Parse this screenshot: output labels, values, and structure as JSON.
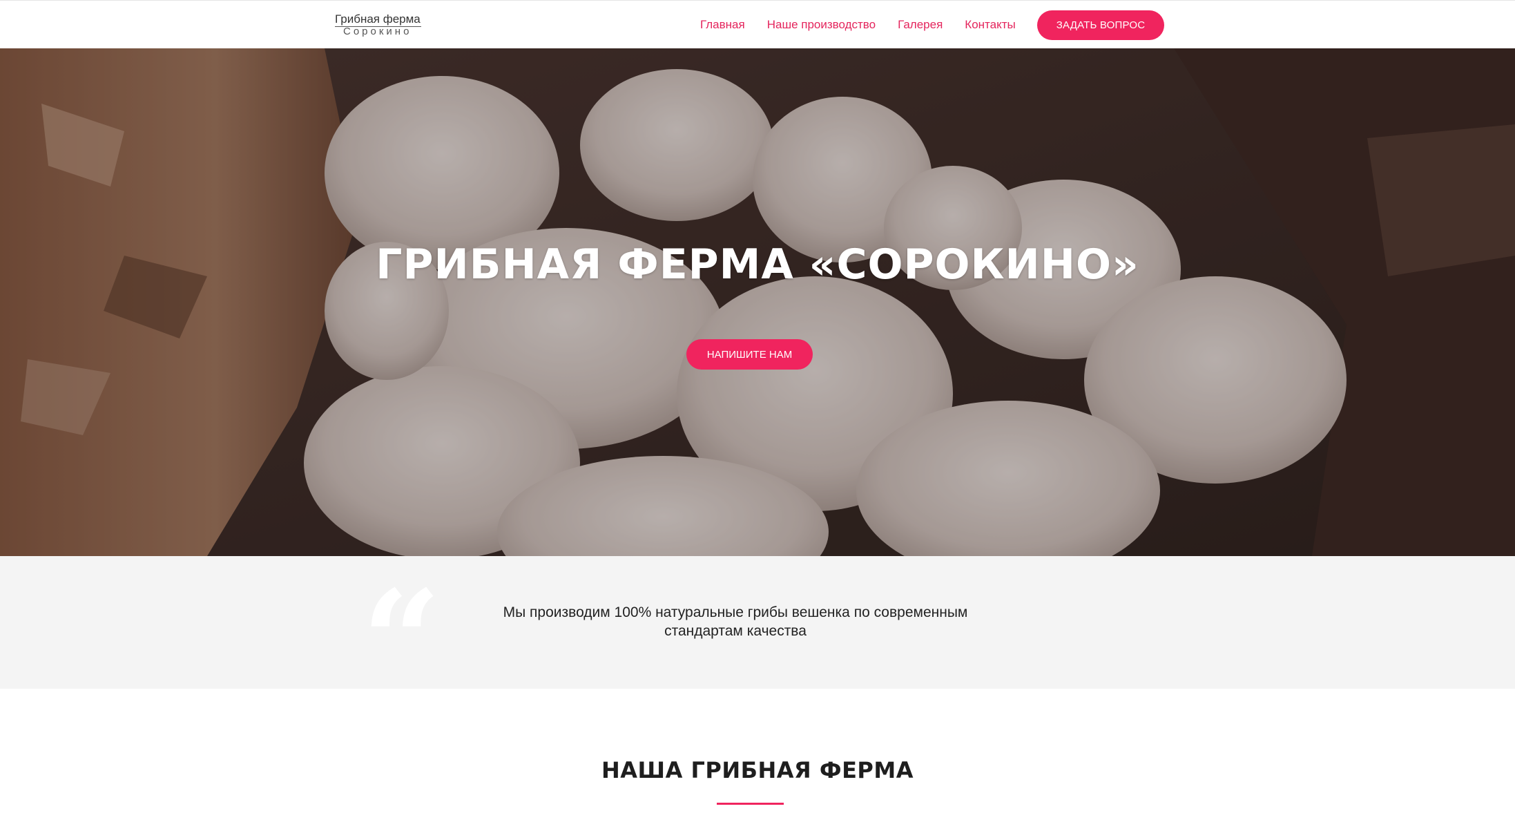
{
  "header": {
    "logo_line1": "Грибная ферма",
    "logo_line2": "Сорокино",
    "nav": [
      {
        "label": "Главная"
      },
      {
        "label": "Наше производство"
      },
      {
        "label": "Галерея"
      },
      {
        "label": "Контакты"
      }
    ],
    "ask_button": "ЗАДАТЬ ВОПРОС"
  },
  "hero": {
    "title": "ГРИБНАЯ ФЕРМА «СОРОКИНО»",
    "button": "НАПИШИТЕ НАМ"
  },
  "quote": {
    "text": "Мы производим 100% натуральные грибы вешенка по современным стандартам качества"
  },
  "section": {
    "title": "НАША ГРИБНАЯ ФЕРМА"
  },
  "colors": {
    "accent": "#f0245e",
    "nav_link": "#e4245c",
    "quote_band": "#f4f4f4"
  }
}
